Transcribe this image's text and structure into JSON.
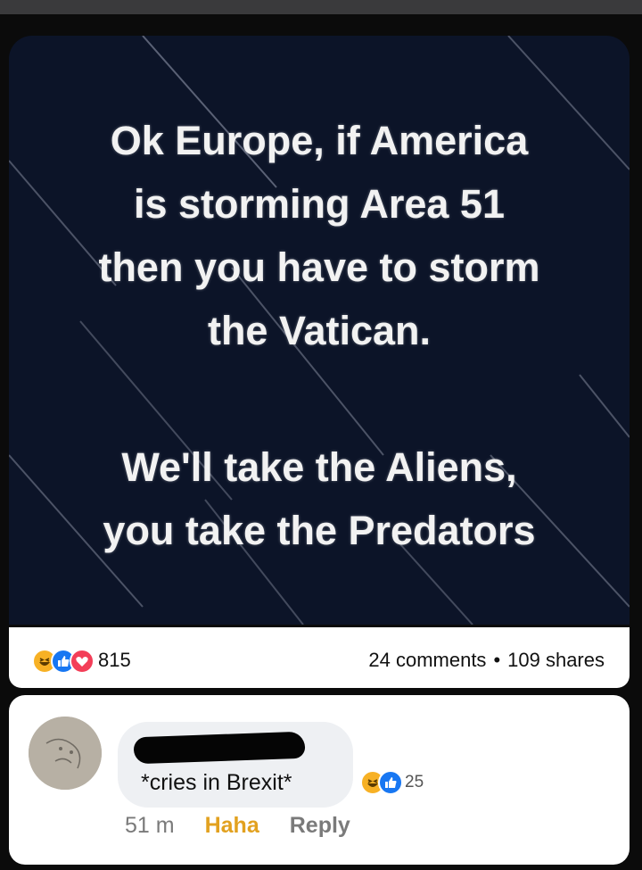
{
  "post": {
    "meme_lines_1": [
      "Ok Europe, if America",
      "is storming Area 51",
      "then you have to storm",
      "the Vatican."
    ],
    "meme_lines_2": [
      "We'll take the Aliens,",
      "you take the Predators"
    ],
    "reaction_count": "815",
    "comments": "24 comments",
    "separator": "•",
    "shares": "109 shares"
  },
  "comment": {
    "text": "*cries in Brexit*",
    "reaction_count": "25",
    "time": "51 m",
    "haha_label": "Haha",
    "reply_label": "Reply"
  },
  "colors": {
    "image_bg": "#0c1428",
    "haha": "#f7b125",
    "like": "#1877f2",
    "love": "#f33e58",
    "haha_text": "#e2a11f"
  }
}
